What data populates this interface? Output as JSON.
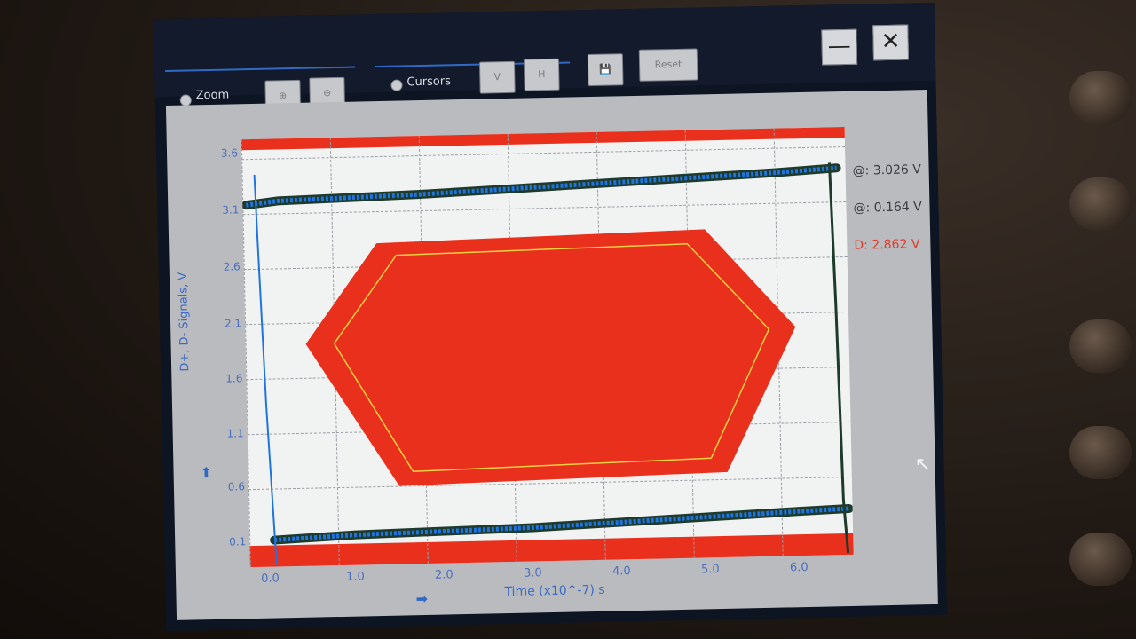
{
  "toolbar": {
    "zoom_label": "Zoom",
    "cursors_label": "Cursors",
    "cursor_v_label": "V",
    "cursor_h_label": "H",
    "reset_label": "Reset",
    "save_icon": "floppy-disk-icon",
    "minimize_label": "—",
    "close_label": "✕"
  },
  "plot": {
    "y_axis_label": "D+, D- Signals, V",
    "x_axis_label": "Time (x10^-7) s",
    "y_ticks": [
      "3.6",
      "3.1",
      "2.6",
      "2.1",
      "1.6",
      "1.1",
      "0.6",
      "0.1"
    ],
    "x_ticks": [
      "0.0",
      "1.0",
      "2.0",
      "3.0",
      "4.0",
      "5.0",
      "6.0"
    ]
  },
  "measurements": {
    "cursor1": "@: 3.026 V",
    "cursor2": "@: 0.164 V",
    "delta": "D: 2.862 V"
  },
  "colors": {
    "mask_red": "#e8301c",
    "trace_blue": "#1f74e0",
    "trace_dark": "#1d3a2a",
    "inner_mask": "#f0d040",
    "measure_dark": "#3a3d44",
    "measure_red": "#e03b2a"
  }
}
